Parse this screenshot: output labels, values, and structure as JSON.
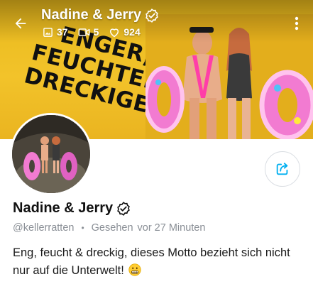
{
  "header": {
    "name": "Nadine & Jerry",
    "stats": {
      "photos": "37",
      "videos": "5",
      "likes": "924"
    }
  },
  "banner": {
    "slogan_lines": [
      "ENGER,",
      "FEUCHTER,",
      "DRECKIGER"
    ]
  },
  "profile": {
    "name": "Nadine & Jerry",
    "username": "@kellerratten",
    "seen_label": "Gesehen",
    "seen_time": "vor 27 Minuten",
    "bio": "Eng, feucht & dreckig, dieses Motto bezieht sich nicht nur auf die Unterwelt!"
  },
  "icons": {
    "back": "arrow-left-icon",
    "photos": "image-icon",
    "videos": "video-icon",
    "likes": "heart-icon",
    "more": "more-vertical-icon",
    "verified": "verified-badge-icon",
    "share": "share-icon",
    "emoji": "grimace-emoji"
  },
  "colors": {
    "banner_yellow": "#f2c32a",
    "accent_blue": "#00aff0",
    "meta_gray": "#8a8f96"
  }
}
